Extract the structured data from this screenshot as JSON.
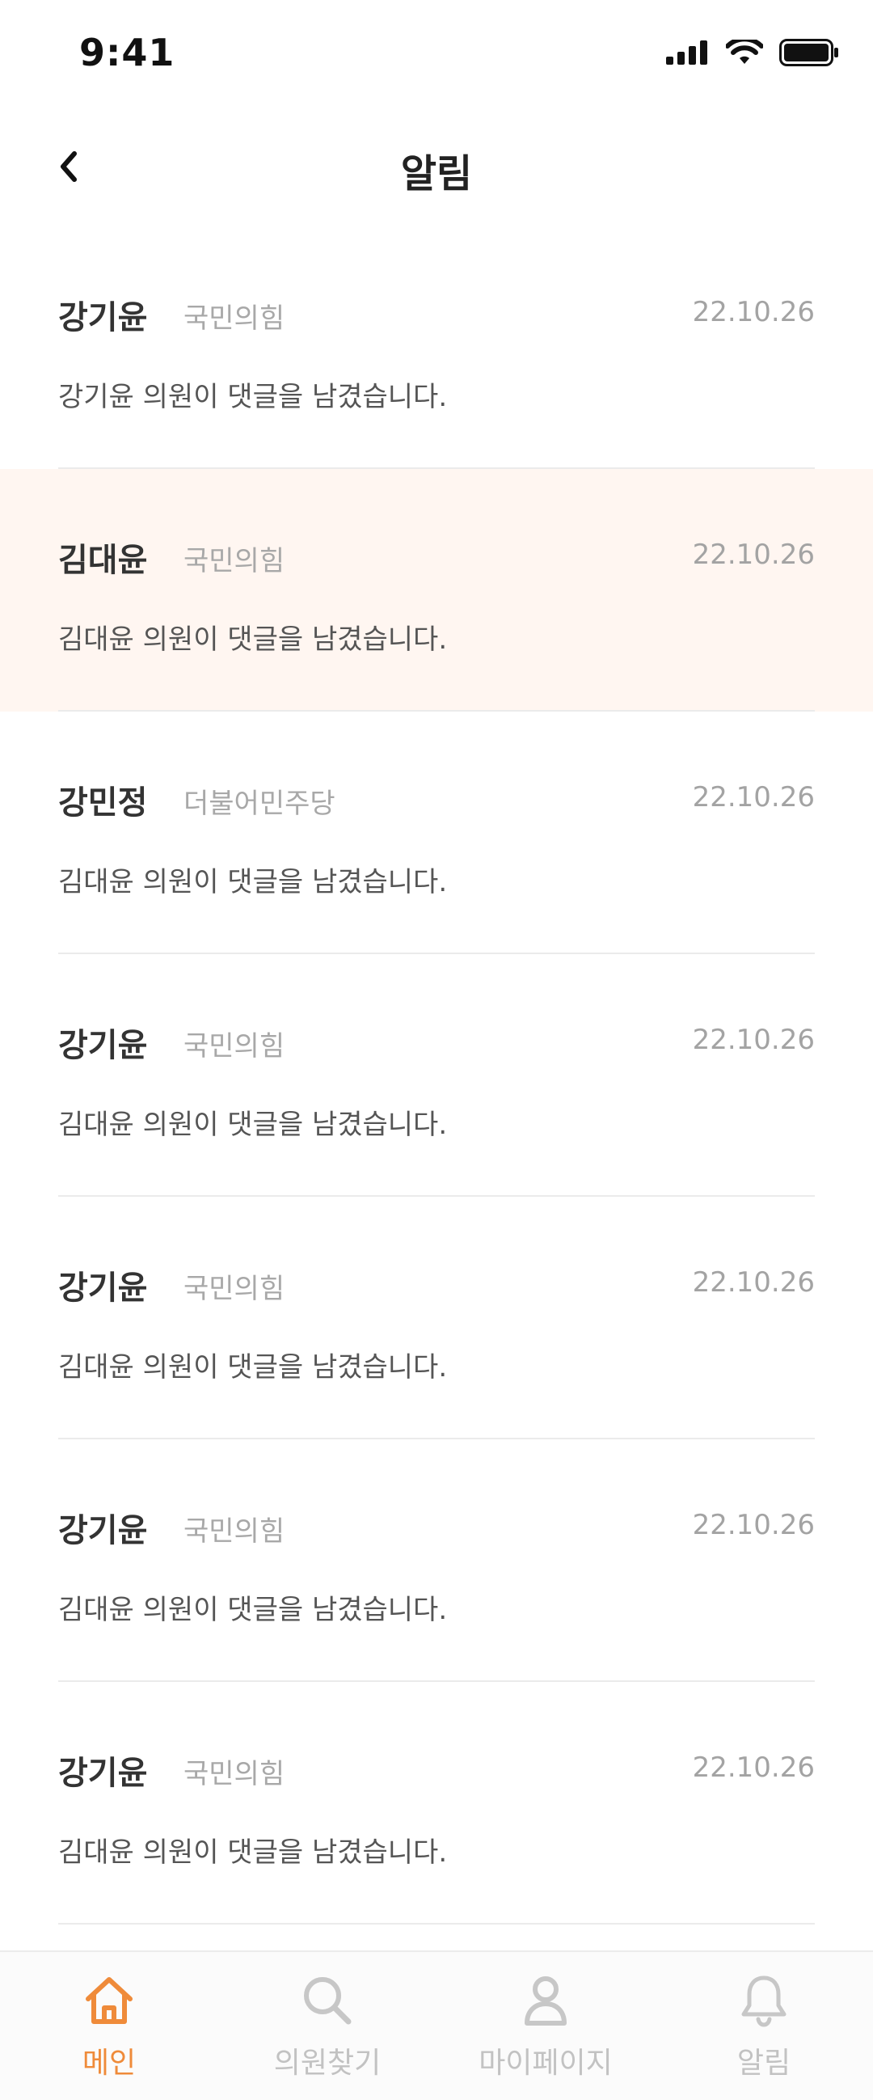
{
  "status_bar": {
    "time": "9:41"
  },
  "header": {
    "title": "알림",
    "back_icon": "chevron-left-icon"
  },
  "notifications": [
    {
      "name": "강기윤",
      "party": "국민의힘",
      "date": "22.10.26",
      "message": "강기윤 의원이 댓글을 남겼습니다.",
      "highlighted": false
    },
    {
      "name": "김대윤",
      "party": "국민의힘",
      "date": "22.10.26",
      "message": "김대윤 의원이 댓글을 남겼습니다.",
      "highlighted": true
    },
    {
      "name": "강민정",
      "party": "더불어민주당",
      "date": "22.10.26",
      "message": "김대윤 의원이 댓글을 남겼습니다.",
      "highlighted": false
    },
    {
      "name": "강기윤",
      "party": "국민의힘",
      "date": "22.10.26",
      "message": "김대윤 의원이 댓글을 남겼습니다.",
      "highlighted": false
    },
    {
      "name": "강기윤",
      "party": "국민의힘",
      "date": "22.10.26",
      "message": "김대윤 의원이 댓글을 남겼습니다.",
      "highlighted": false
    },
    {
      "name": "강기윤",
      "party": "국민의힘",
      "date": "22.10.26",
      "message": "김대윤 의원이 댓글을 남겼습니다.",
      "highlighted": false
    },
    {
      "name": "강기윤",
      "party": "국민의힘",
      "date": "22.10.26",
      "message": "김대윤 의원이 댓글을 남겼습니다.",
      "highlighted": false
    }
  ],
  "bottom_nav": {
    "items": [
      {
        "label": "메인",
        "icon": "home-icon",
        "active": true
      },
      {
        "label": "의원찾기",
        "icon": "search-icon",
        "active": false
      },
      {
        "label": "마이페이지",
        "icon": "user-icon",
        "active": false
      },
      {
        "label": "알림",
        "icon": "bell-icon",
        "active": false
      }
    ]
  },
  "colors": {
    "accent": "#ef8b3a",
    "highlight_bg": "#fff6f1",
    "inactive": "#c2c2c2"
  }
}
